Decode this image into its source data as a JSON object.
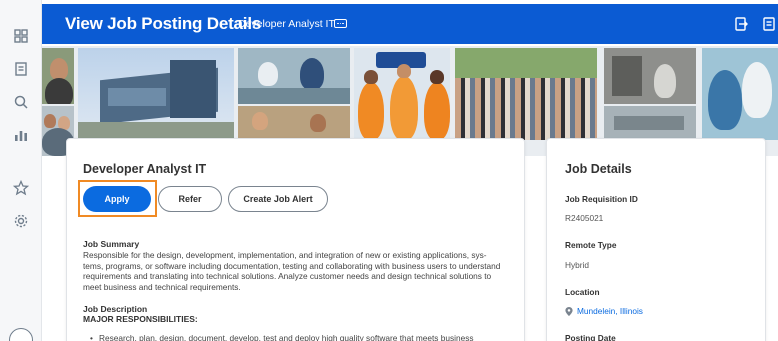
{
  "header": {
    "title": "View Job Posting Details",
    "subtitle": "Developer Analyst IT",
    "more_icon": "ellipsis-icon",
    "right_icons": [
      "export-icon",
      "print-icon"
    ],
    "color": "#0b5bd3"
  },
  "rail": {
    "icons": [
      "grid-icon",
      "document-icon",
      "search-icon",
      "bar-chart-icon",
      "star-icon",
      "gear-icon"
    ]
  },
  "job": {
    "title": "Developer Analyst IT",
    "actions": {
      "apply": "Apply",
      "refer": "Refer",
      "create_alert": "Create Job Alert"
    },
    "summary_heading": "Job Summary",
    "summary_lines": [
      "Responsible for the design, development, implementation, and integration of new or existing applications, sys-",
      "tems, programs, or software including documentation, testing and collaborating with business users to understand",
      "requirements and translating into technical solutions. Analyze customer needs and design technical solutions to",
      "meet business and technical requirements."
    ],
    "description_heading": "Job Description",
    "responsibilities_heading": "MAJOR RESPONSIBILITIES:",
    "first_bullet": "Research, plan, design, document, develop, test and deploy high quality software that meets business"
  },
  "details": {
    "title": "Job Details",
    "requisition_label": "Job Requisition ID",
    "requisition_value": "R2405021",
    "remote_label": "Remote Type",
    "remote_value": "Hybrid",
    "location_label": "Location",
    "location_value": "Mundelein, Illinois",
    "posting_label": "Posting Date"
  },
  "colors": {
    "accent": "#0b6be0",
    "highlight": "#f08a24"
  }
}
